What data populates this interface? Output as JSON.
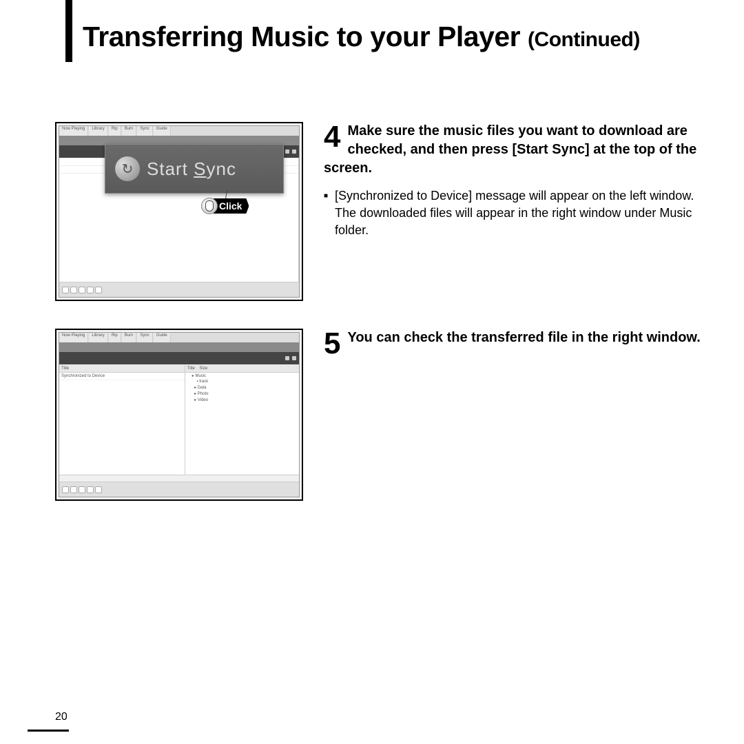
{
  "title": {
    "main": "Transferring Music to your Player",
    "suffix": "(Continued)"
  },
  "steps": {
    "4": {
      "number": "4",
      "bold": "Make sure the music files you want to download are checked, and then press [Start Sync] at the top of the screen.",
      "bullet_marker": "■",
      "detail": "[Synchronized to Device] message will appear on the left window. The downloaded files will appear in the right window under Music folder.",
      "overlay_button_prefix": "Start ",
      "overlay_button_underlined": "S",
      "overlay_button_rest": "ync",
      "click_label": "Click"
    },
    "5": {
      "number": "5",
      "bold": "You can check the transferred file in the right window."
    }
  },
  "page_number": "20"
}
